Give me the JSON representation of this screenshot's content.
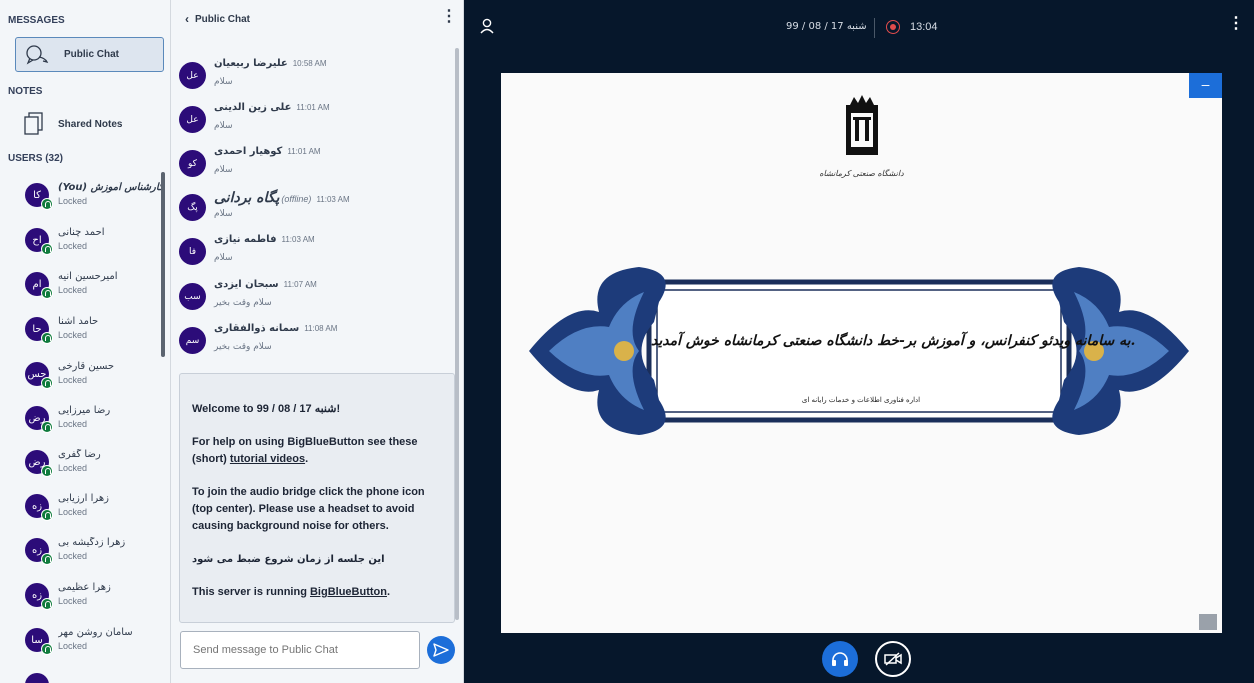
{
  "sidebar": {
    "messages_title": "MESSAGES",
    "public_chat_label": "Public Chat",
    "notes_title": "NOTES",
    "shared_notes_label": "Shared Notes",
    "users_title": "USERS (32)",
    "users": [
      {
        "name": "(You) کارشناس آموزش",
        "initials": "کا",
        "status": "Locked"
      },
      {
        "name": "احمد چنانی",
        "initials": "اح",
        "status": "Locked"
      },
      {
        "name": "امیرحسین انیه",
        "initials": "ام",
        "status": "Locked"
      },
      {
        "name": "حامد اشنا",
        "initials": "حا",
        "status": "Locked"
      },
      {
        "name": "حسین قارخی",
        "initials": "حس",
        "status": "Locked"
      },
      {
        "name": "رضا میرزایی",
        "initials": "رض",
        "status": "Locked"
      },
      {
        "name": "رضا گفری",
        "initials": "رض",
        "status": "Locked"
      },
      {
        "name": "زهرا ارزیابی",
        "initials": "زه",
        "status": "Locked"
      },
      {
        "name": "زهرا زدگیشه بی",
        "initials": "زه",
        "status": "Locked"
      },
      {
        "name": "زهرا عظیمی",
        "initials": "زه",
        "status": "Locked"
      },
      {
        "name": "سامان روشن مهر",
        "initials": "سا",
        "status": "Locked"
      }
    ]
  },
  "chat": {
    "back_label": "Public Chat",
    "messages": [
      {
        "author": "علیرضا ربیعیان",
        "initials": "عل",
        "time": "10:58 AM",
        "text": "سلام"
      },
      {
        "author": "علی زین الدینی",
        "initials": "عل",
        "time": "11:01 AM",
        "text": "سلام"
      },
      {
        "author": "کوهیار احمدی",
        "initials": "کو",
        "time": "11:01 AM",
        "text": "سلام"
      },
      {
        "author": "پگاه بردانی",
        "initials": "پگ",
        "time": "11:03 AM",
        "text": "سلام",
        "offline": "(offline)"
      },
      {
        "author": "فاطمه نیازی",
        "initials": "فا",
        "time": "11:03 AM",
        "text": "سلام"
      },
      {
        "author": "سبحان ایزدی",
        "initials": "سب",
        "time": "11:07 AM",
        "text": "سلام وقت بخیر"
      },
      {
        "author": "سمانه ذوالفقاری",
        "initials": "سم",
        "time": "11:08 AM",
        "text": "سلام وقت بخیر"
      }
    ],
    "welcome": {
      "line1": "Welcome to 99 / 08 / 17 شنبه!",
      "line2_prefix": "For help on using BigBlueButton see these (short) ",
      "line2_link": "tutorial videos",
      "line2_suffix": ".",
      "line3": "To join the audio bridge click the phone icon (top center). Please use a headset to avoid causing background noise for others.",
      "line4": "این جلسه از زمان شروع ضبط می شود",
      "line5_prefix": "This server is running ",
      "line5_link": "BigBlueButton",
      "line5_suffix": "."
    },
    "input_placeholder": "Send message to Public Chat"
  },
  "topbar": {
    "date": "99 / 08 / 17 شنبه",
    "record_time": "13:04"
  },
  "slide": {
    "university": "دانشگاه صنعتی کرمانشاه",
    "welcome_text": "به سامانه ویدئو کنفرانس، و آموزش بر-خط دانشگاه صنعتی کرمانشاه خوش آمدید.",
    "office_text": "اداره فناوری اطلاعات و خدمات رایانه ای",
    "minimize_label": "–"
  },
  "colors": {
    "accent": "#1c6ed9",
    "avatar": "#2c0c79",
    "background": "#06172b",
    "record": "#e24c4c"
  }
}
